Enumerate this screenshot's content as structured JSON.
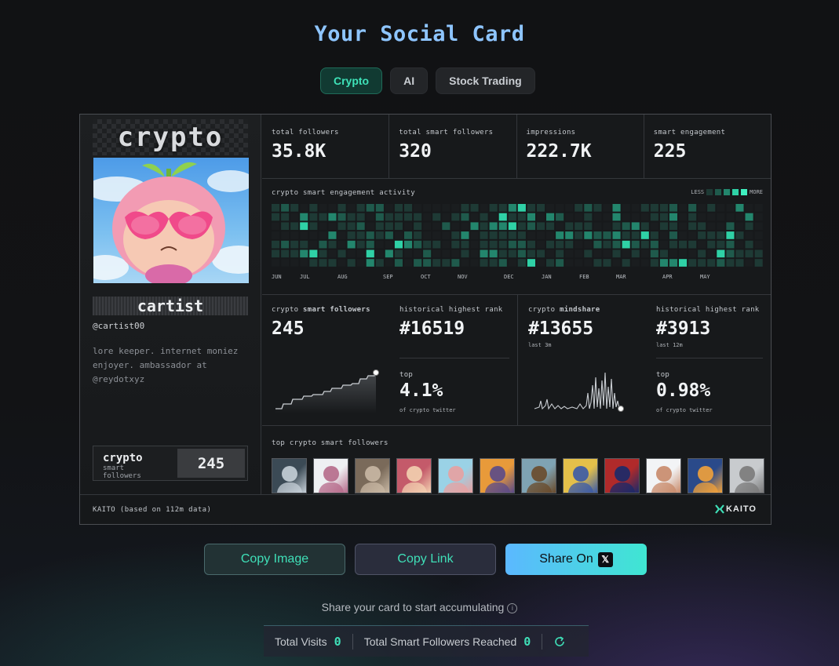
{
  "page": {
    "title": "Your Social Card"
  },
  "tabs": [
    {
      "label": "Crypto",
      "active": true
    },
    {
      "label": "AI",
      "active": false
    },
    {
      "label": "Stock Trading",
      "active": false
    }
  ],
  "card": {
    "category_title": "crypto",
    "profile": {
      "name": "cartist",
      "handle": "@cartist00",
      "bio": "lore keeper. internet moniez enjoyer. ambassador at @reydotxyz",
      "smart_followers_label": "crypto",
      "smart_followers_sublabel": "smart followers",
      "smart_followers_value": "245"
    },
    "stats": [
      {
        "label": "total followers",
        "value": "35.8K"
      },
      {
        "label": "total smart followers",
        "value": "320"
      },
      {
        "label": "impressions",
        "value": "222.7K"
      },
      {
        "label": "smart engagement",
        "value": "225"
      }
    ],
    "activity": {
      "title": "crypto smart engagement activity",
      "legend_less": "LESS",
      "legend_more": "MORE",
      "months": [
        "JUN",
        "JUL",
        "AUG",
        "SEP",
        "OCT",
        "NOV",
        "DEC",
        "JAN",
        "FEB",
        "MAR",
        "APR",
        "MAY"
      ]
    },
    "panel_followers": {
      "title_prefix": "crypto ",
      "title_strong": "smart followers",
      "value": "245",
      "rank_label": "historical highest rank",
      "rank_value": "#16519",
      "top_label": "top",
      "top_value": "4.1%",
      "top_sub": "of crypto twitter"
    },
    "panel_mindshare": {
      "title_prefix": "crypto ",
      "title_strong": "mindshare",
      "value": "#13655",
      "value_sub": "last 3m",
      "rank_label": "historical highest rank",
      "rank_value": "#3913",
      "rank_sub": "last 12m",
      "top_label": "top",
      "top_value": "0.98%",
      "top_sub": "of crypto twitter"
    },
    "top_followers": {
      "title": "top crypto smart followers",
      "count": 12
    },
    "footer": {
      "text": "KAITO (based on 112m data)",
      "logo": "KAITO"
    }
  },
  "actions": {
    "copy_image": "Copy Image",
    "copy_link": "Copy Link",
    "share": "Share On",
    "share_icon": "x-logo-icon"
  },
  "bottom": {
    "note": "Share your card to start accumulating",
    "total_visits_label": "Total Visits",
    "total_visits_value": "0",
    "smart_reached_label": "Total Smart Followers Reached",
    "smart_reached_value": "0"
  },
  "colors": {
    "accent": "#3fe0b8",
    "title": "#8ec5ff",
    "heat_levels": [
      "#1e3a35",
      "#1f5a4c",
      "#23866d",
      "#2fd1a6"
    ]
  }
}
